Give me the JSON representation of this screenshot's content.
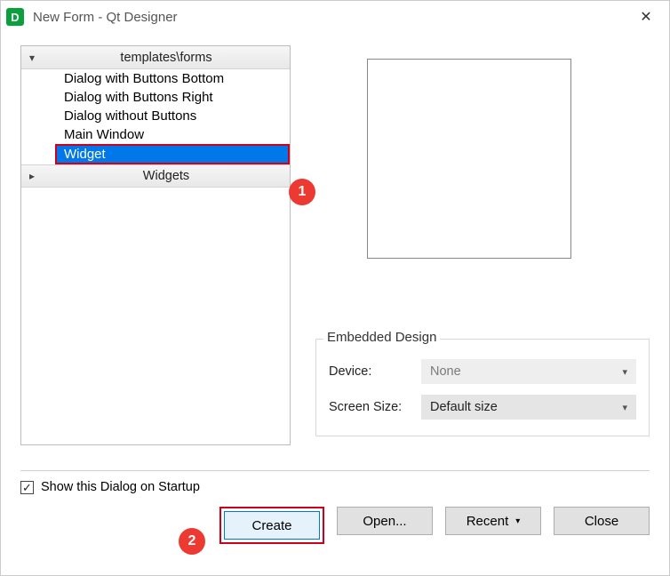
{
  "window": {
    "title": "New Form - Qt Designer"
  },
  "tree": {
    "category1": "templates\\forms",
    "items": [
      "Dialog with Buttons Bottom",
      "Dialog with Buttons Right",
      "Dialog without Buttons",
      "Main Window",
      "Widget"
    ],
    "category2": "Widgets"
  },
  "embedded": {
    "legend": "Embedded Design",
    "device_label": "Device:",
    "device_value": "None",
    "screen_label": "Screen Size:",
    "screen_value": "Default size"
  },
  "footer": {
    "checkbox_label": "Show this Dialog on Startup",
    "create": "Create",
    "open": "Open...",
    "recent": "Recent",
    "close": "Close"
  },
  "callouts": {
    "c1": "1",
    "c2": "2"
  }
}
